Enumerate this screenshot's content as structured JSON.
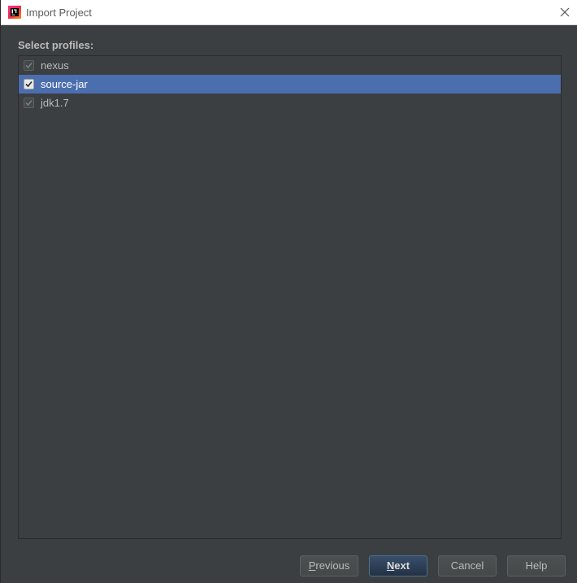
{
  "window": {
    "title": "Import Project",
    "app_icon": "intellij-idea-icon",
    "close_icon": "close-icon"
  },
  "profiles": {
    "label": "Select profiles:",
    "items": [
      {
        "label": "nexus",
        "checked": true,
        "selected": false
      },
      {
        "label": "source-jar",
        "checked": true,
        "selected": true
      },
      {
        "label": "jdk1.7",
        "checked": true,
        "selected": false
      }
    ]
  },
  "buttons": {
    "previous": {
      "mnemonic": "P",
      "rest": "revious"
    },
    "next": {
      "mnemonic": "N",
      "rest": "ext"
    },
    "cancel": "Cancel",
    "help": "Help"
  },
  "colors": {
    "background": "#3c3f41",
    "selection": "#4b6eaf",
    "text": "#bbbbbb"
  }
}
